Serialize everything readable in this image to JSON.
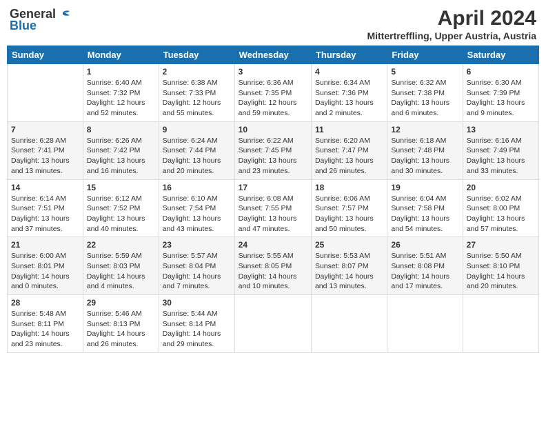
{
  "header": {
    "logo_general": "General",
    "logo_blue": "Blue",
    "month_title": "April 2024",
    "location": "Mittertreffling, Upper Austria, Austria"
  },
  "days_of_week": [
    "Sunday",
    "Monday",
    "Tuesday",
    "Wednesday",
    "Thursday",
    "Friday",
    "Saturday"
  ],
  "weeks": [
    [
      {
        "day": "",
        "info": ""
      },
      {
        "day": "1",
        "info": "Sunrise: 6:40 AM\nSunset: 7:32 PM\nDaylight: 12 hours\nand 52 minutes."
      },
      {
        "day": "2",
        "info": "Sunrise: 6:38 AM\nSunset: 7:33 PM\nDaylight: 12 hours\nand 55 minutes."
      },
      {
        "day": "3",
        "info": "Sunrise: 6:36 AM\nSunset: 7:35 PM\nDaylight: 12 hours\nand 59 minutes."
      },
      {
        "day": "4",
        "info": "Sunrise: 6:34 AM\nSunset: 7:36 PM\nDaylight: 13 hours\nand 2 minutes."
      },
      {
        "day": "5",
        "info": "Sunrise: 6:32 AM\nSunset: 7:38 PM\nDaylight: 13 hours\nand 6 minutes."
      },
      {
        "day": "6",
        "info": "Sunrise: 6:30 AM\nSunset: 7:39 PM\nDaylight: 13 hours\nand 9 minutes."
      }
    ],
    [
      {
        "day": "7",
        "info": "Sunrise: 6:28 AM\nSunset: 7:41 PM\nDaylight: 13 hours\nand 13 minutes."
      },
      {
        "day": "8",
        "info": "Sunrise: 6:26 AM\nSunset: 7:42 PM\nDaylight: 13 hours\nand 16 minutes."
      },
      {
        "day": "9",
        "info": "Sunrise: 6:24 AM\nSunset: 7:44 PM\nDaylight: 13 hours\nand 20 minutes."
      },
      {
        "day": "10",
        "info": "Sunrise: 6:22 AM\nSunset: 7:45 PM\nDaylight: 13 hours\nand 23 minutes."
      },
      {
        "day": "11",
        "info": "Sunrise: 6:20 AM\nSunset: 7:47 PM\nDaylight: 13 hours\nand 26 minutes."
      },
      {
        "day": "12",
        "info": "Sunrise: 6:18 AM\nSunset: 7:48 PM\nDaylight: 13 hours\nand 30 minutes."
      },
      {
        "day": "13",
        "info": "Sunrise: 6:16 AM\nSunset: 7:49 PM\nDaylight: 13 hours\nand 33 minutes."
      }
    ],
    [
      {
        "day": "14",
        "info": "Sunrise: 6:14 AM\nSunset: 7:51 PM\nDaylight: 13 hours\nand 37 minutes."
      },
      {
        "day": "15",
        "info": "Sunrise: 6:12 AM\nSunset: 7:52 PM\nDaylight: 13 hours\nand 40 minutes."
      },
      {
        "day": "16",
        "info": "Sunrise: 6:10 AM\nSunset: 7:54 PM\nDaylight: 13 hours\nand 43 minutes."
      },
      {
        "day": "17",
        "info": "Sunrise: 6:08 AM\nSunset: 7:55 PM\nDaylight: 13 hours\nand 47 minutes."
      },
      {
        "day": "18",
        "info": "Sunrise: 6:06 AM\nSunset: 7:57 PM\nDaylight: 13 hours\nand 50 minutes."
      },
      {
        "day": "19",
        "info": "Sunrise: 6:04 AM\nSunset: 7:58 PM\nDaylight: 13 hours\nand 54 minutes."
      },
      {
        "day": "20",
        "info": "Sunrise: 6:02 AM\nSunset: 8:00 PM\nDaylight: 13 hours\nand 57 minutes."
      }
    ],
    [
      {
        "day": "21",
        "info": "Sunrise: 6:00 AM\nSunset: 8:01 PM\nDaylight: 14 hours\nand 0 minutes."
      },
      {
        "day": "22",
        "info": "Sunrise: 5:59 AM\nSunset: 8:03 PM\nDaylight: 14 hours\nand 4 minutes."
      },
      {
        "day": "23",
        "info": "Sunrise: 5:57 AM\nSunset: 8:04 PM\nDaylight: 14 hours\nand 7 minutes."
      },
      {
        "day": "24",
        "info": "Sunrise: 5:55 AM\nSunset: 8:05 PM\nDaylight: 14 hours\nand 10 minutes."
      },
      {
        "day": "25",
        "info": "Sunrise: 5:53 AM\nSunset: 8:07 PM\nDaylight: 14 hours\nand 13 minutes."
      },
      {
        "day": "26",
        "info": "Sunrise: 5:51 AM\nSunset: 8:08 PM\nDaylight: 14 hours\nand 17 minutes."
      },
      {
        "day": "27",
        "info": "Sunrise: 5:50 AM\nSunset: 8:10 PM\nDaylight: 14 hours\nand 20 minutes."
      }
    ],
    [
      {
        "day": "28",
        "info": "Sunrise: 5:48 AM\nSunset: 8:11 PM\nDaylight: 14 hours\nand 23 minutes."
      },
      {
        "day": "29",
        "info": "Sunrise: 5:46 AM\nSunset: 8:13 PM\nDaylight: 14 hours\nand 26 minutes."
      },
      {
        "day": "30",
        "info": "Sunrise: 5:44 AM\nSunset: 8:14 PM\nDaylight: 14 hours\nand 29 minutes."
      },
      {
        "day": "",
        "info": ""
      },
      {
        "day": "",
        "info": ""
      },
      {
        "day": "",
        "info": ""
      },
      {
        "day": "",
        "info": ""
      }
    ]
  ]
}
